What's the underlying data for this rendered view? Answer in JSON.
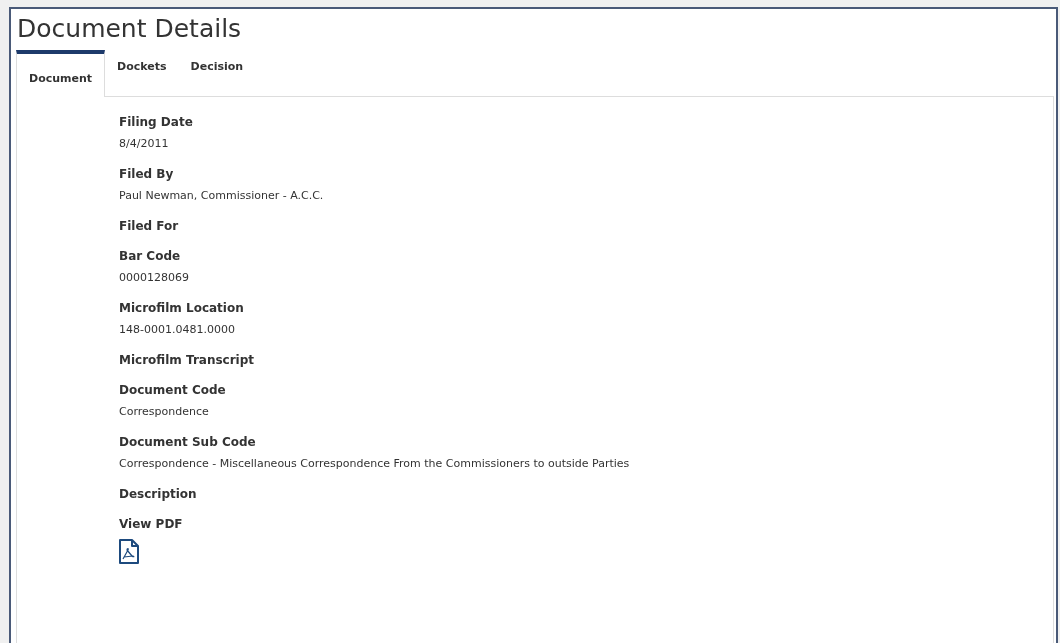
{
  "title": "Document Details",
  "tabs": [
    {
      "label": "Document",
      "selected": true
    },
    {
      "label": "Dockets",
      "selected": false
    },
    {
      "label": "Decision",
      "selected": false
    }
  ],
  "fields": [
    {
      "kind": "text",
      "label": "Filing Date",
      "value": "8/4/2011"
    },
    {
      "kind": "text",
      "label": "Filed By",
      "value": "Paul Newman, Commissioner - A.C.C."
    },
    {
      "kind": "text",
      "label": "Filed For"
    },
    {
      "kind": "text",
      "label": "Bar Code",
      "value": "0000128069"
    },
    {
      "kind": "text",
      "label": "Microfilm Location",
      "value": "148-0001.0481.0000"
    },
    {
      "kind": "text",
      "label": "Microfilm Transcript"
    },
    {
      "kind": "text",
      "label": "Document Code",
      "value": "Correspondence"
    },
    {
      "kind": "text",
      "label": "Document Sub Code",
      "value": "Correspondence - Miscellaneous Correspondence From the Commissioners to outside Parties"
    },
    {
      "kind": "text",
      "label": "Description"
    },
    {
      "kind": "pdf",
      "label": "View PDF"
    }
  ]
}
